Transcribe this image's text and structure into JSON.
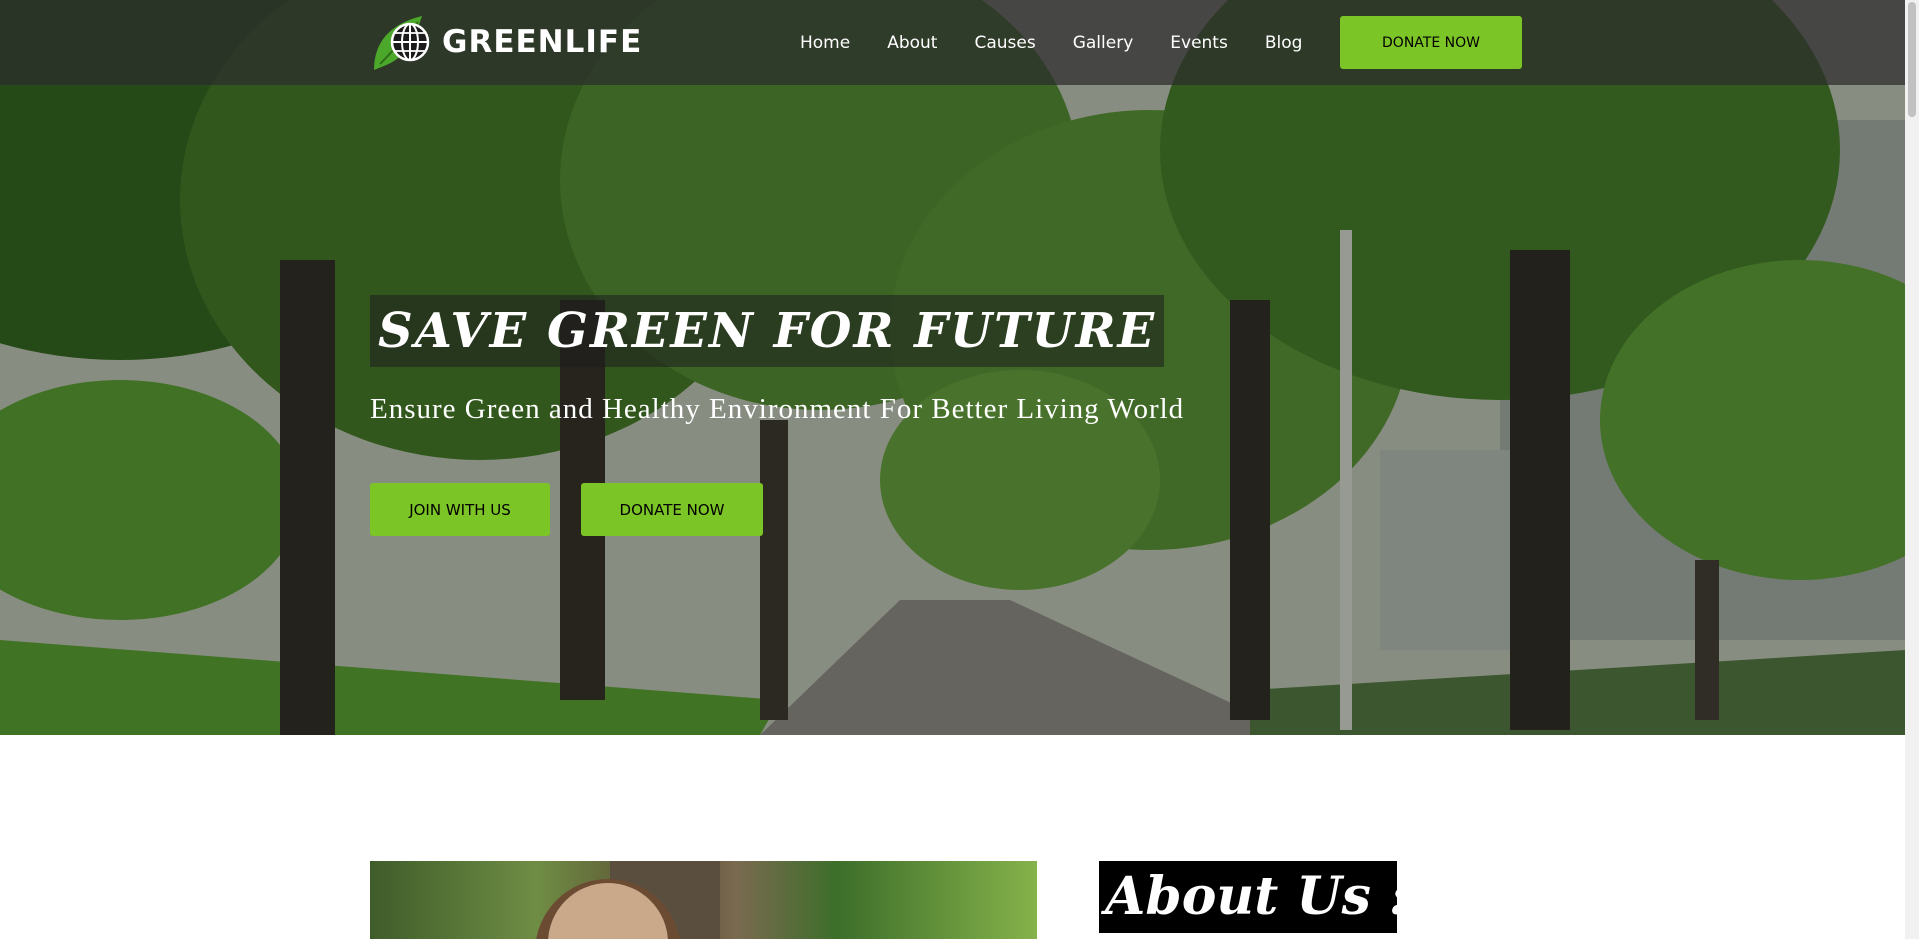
{
  "brand": {
    "name": "GREENLIFE",
    "accent": "#7cc527"
  },
  "nav": {
    "items": [
      "Home",
      "About",
      "Causes",
      "Gallery",
      "Events",
      "Blog"
    ],
    "donate_label": "DONATE NOW"
  },
  "hero": {
    "title": "SAVE GREEN FOR FUTURE",
    "subtitle": "Ensure Green and Healthy Environment For Better Living World",
    "join_label": "JOIN WITH US",
    "donate_label": "DONATE NOW"
  },
  "about": {
    "heading": "About Us :-"
  }
}
